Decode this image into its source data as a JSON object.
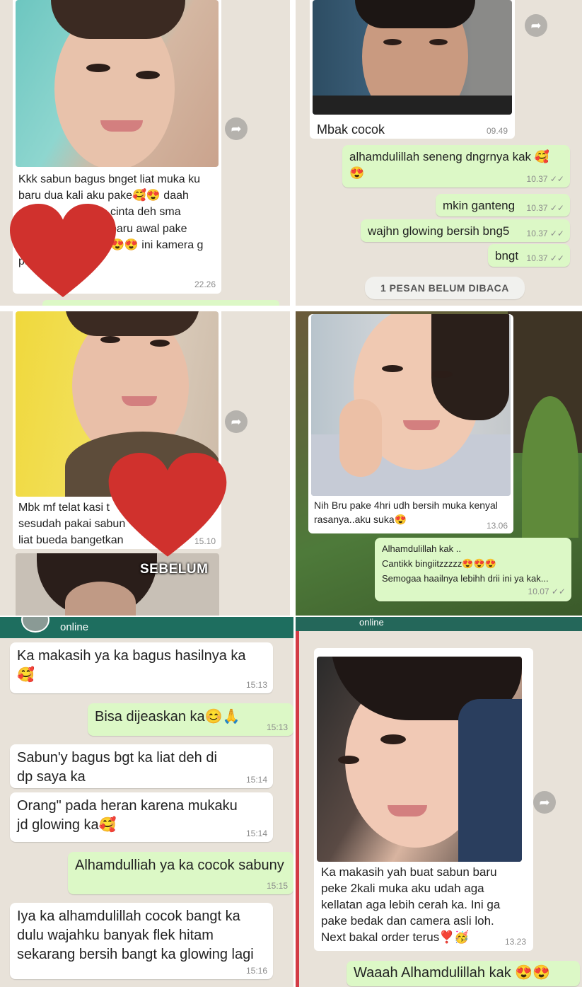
{
  "p1": {
    "caption": [
      "Kkk sabun bagus bnget liat muka ku",
      "baru dua kali aku pake🥰😍 daah",
      "cinta deh sma",
      "baru awal pake",
      "😍😍 ini kamera g",
      "pake asli😍😍"
    ],
    "time": "22.26"
  },
  "p2": {
    "caption": "Mbak cocok",
    "caption_time": "09.49",
    "messages": [
      {
        "text": "alhamdulillah  seneng dngrnya kak 🥰😍",
        "time": "10.37"
      },
      {
        "text": "mkin ganteng",
        "time": "10.37"
      },
      {
        "text": "wajhn glowing bersih bng5",
        "time": "10.37"
      },
      {
        "text": "bngt",
        "time": "10.37"
      }
    ],
    "unread": "1 PESAN BELUM DIBACA"
  },
  "p3": {
    "caption": [
      "Mbk mf telat kasi t",
      "sesudah pakai sabun",
      "liat bueda bangetkan"
    ],
    "time": "15.10",
    "label": "SEBELUM"
  },
  "p4": {
    "caption": [
      "Nih Bru pake 4hri udh bersih muka kenyal",
      "rasanya..aku suka😍"
    ],
    "time": "13.06",
    "reply": [
      "Alhamdulillah kak ..",
      "Cantikk bingiitzzzzz😍😍😍",
      "Semogaa haailnya lebihh drii ini ya kak..."
    ],
    "reply_time": "10.07"
  },
  "p5": {
    "status": "online",
    "messages": [
      {
        "dir": "in",
        "text": "Ka makasih ya ka bagus hasilnya ka 🥰",
        "time": "15:13"
      },
      {
        "dir": "out",
        "text": "Bisa dijeaskan ka😊🙏",
        "time": "15:13"
      },
      {
        "dir": "in",
        "text": "Sabun'y bagus bgt ka liat deh di dp saya ka",
        "time": "15:14"
      },
      {
        "dir": "in",
        "text": "Orang\" pada heran karena mukaku jd glowing ka🥰",
        "time": "15:14"
      },
      {
        "dir": "out",
        "text": "Alhamdulliah ya ka cocok sabuny",
        "time": "15:15"
      },
      {
        "dir": "in",
        "text": "Iya ka alhamdulillah cocok bangt ka dulu wajahku banyak flek hitam sekarang bersih bangt ka glowing lagi",
        "time": "15:16"
      }
    ]
  },
  "p6": {
    "header": "online",
    "caption": [
      "Ka makasih yah buat sabun baru",
      "peke 2kali muka aku udah aga",
      "kellatan aga lebih cerah ka. Ini ga",
      "pake bedak dan camera asli loh.",
      "Next bakal order terus❣️🥳"
    ],
    "time": "13.23",
    "reply": "Waaah Alhamdulillah kak 😍😍"
  },
  "colors": {
    "wa_bg": "#e8e2d9",
    "bubble_out": "#dcf8c6",
    "bubble_in": "#ffffff",
    "heart": "#d0312d",
    "header": "#1e6e5f"
  }
}
